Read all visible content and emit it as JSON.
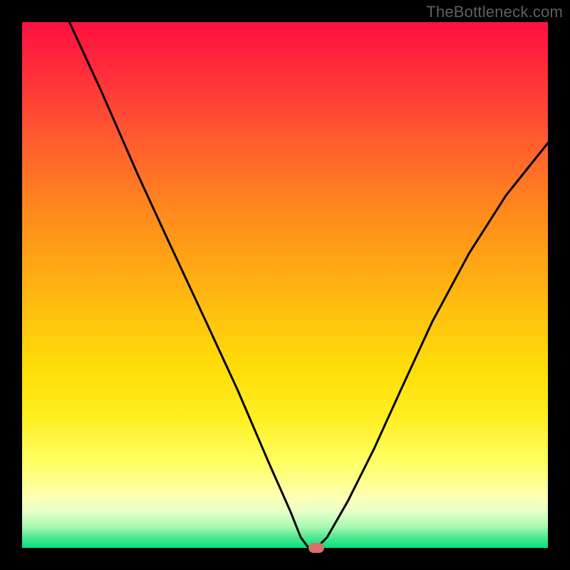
{
  "watermark": "TheBottleneck.com",
  "chart_data": {
    "type": "line",
    "title": "",
    "xlabel": "",
    "ylabel": "",
    "xlim": [
      0,
      100
    ],
    "ylim": [
      0,
      100
    ],
    "background_gradient": {
      "top": "#ff1040",
      "upper_mid": "#ffa015",
      "mid": "#ffff66",
      "bottom": "#00e080"
    },
    "series": [
      {
        "name": "bottleneck-curve",
        "x": [
          9,
          15,
          22,
          28,
          35,
          41,
          47,
          51,
          53,
          54.5,
          56,
          58,
          62,
          67,
          72,
          78,
          85,
          92,
          100
        ],
        "y": [
          100,
          87,
          71,
          58,
          43,
          30,
          16,
          7,
          2,
          0,
          0,
          2,
          9,
          19,
          30,
          43,
          56,
          67,
          77
        ],
        "color": "#000000",
        "stroke_width": 3
      }
    ],
    "marker": {
      "name": "optimal-point",
      "x": 56,
      "y": 0,
      "color": "#d9706a"
    }
  }
}
